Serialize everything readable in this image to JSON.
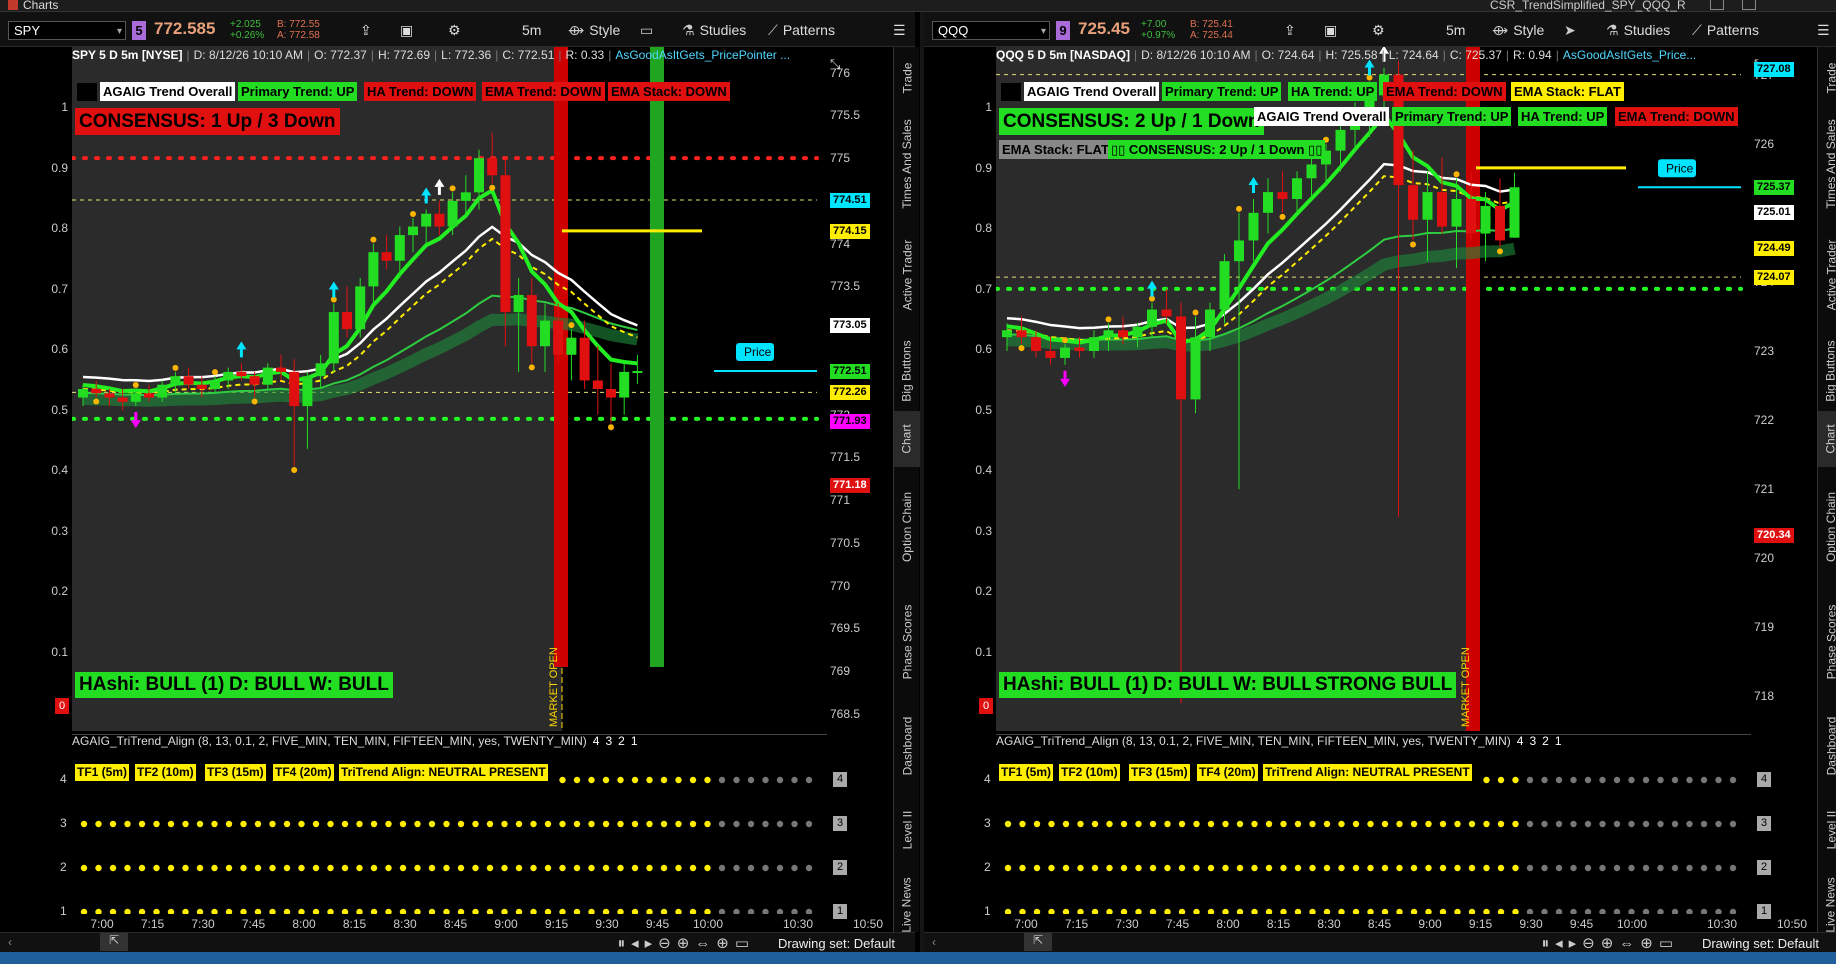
{
  "app": {
    "title": "Charts",
    "window_right": "CSR_TrendSimplified_SPY_QQQ_R"
  },
  "toolbar": {
    "style": "Style",
    "studies": "Studies",
    "patterns": "Patterns"
  },
  "vtabs": [
    "Trade",
    "Times And Sales",
    "Active Trader",
    "Big Buttons",
    "Chart",
    "Option Chain",
    "Phase Scores",
    "Dashboard",
    "Level II",
    "Live News"
  ],
  "left_axis": [
    "1",
    "0.9",
    "0.8",
    "0.7",
    "0.6",
    "0.5",
    "0.4",
    "0.3",
    "0.2",
    "0.1"
  ],
  "lower_axis": [
    "4",
    "3",
    "2",
    "1"
  ],
  "x_ticks": [
    "7:00",
    "7:15",
    "7:30",
    "7:45",
    "8:00",
    "8:15",
    "8:30",
    "8:45",
    "9:00",
    "9:15",
    "9:30",
    "9:45",
    "10:00",
    "10:30",
    "10:50"
  ],
  "bottom": {
    "drawing_set": "Drawing set: Default"
  },
  "common": {
    "market_open": "MARKET OPEN",
    "price_label": "Price",
    "zero_badge": "0"
  },
  "colors": {
    "up": "#22dd22",
    "down": "#e01010",
    "ema_white": "#ffffff",
    "yellow": "#ffee00",
    "cyan": "#00e5ff",
    "magenta": "#ff00ff"
  },
  "spy": {
    "symbol": "SPY",
    "link": "5",
    "last": "772.585",
    "change": "+2.025",
    "change_pct": "+0.26%",
    "bid": "B: 772.55",
    "ask": "A: 772.58",
    "interval": "5m",
    "info": {
      "title": "SPY 5 D 5m [NYSE]",
      "date": "D: 8/12/26 10:10 AM",
      "open": "O: 772.37",
      "high": "H: 772.69",
      "low": "L: 772.36",
      "close": "C: 772.51",
      "range": "R: 0.33",
      "study": "AsGoodAsItGets_PricePointer ..."
    },
    "labels": [
      "AGAIG Trend Overall",
      "Primary Trend: UP",
      "HA Trend: DOWN",
      "EMA Trend: DOWN",
      "EMA Stack: DOWN"
    ],
    "consensus": "CONSENSUS: 1 Up / 3 Down",
    "bulls": [
      "HAshi: BULL (1)",
      "D: BULL",
      "W: BULL"
    ],
    "price_axis": [
      "776",
      "775.5",
      "775",
      "774",
      "773.5",
      "772.5",
      "772",
      "771.5",
      "771",
      "770.5",
      "770",
      "769.5",
      "769",
      "768.5"
    ],
    "bubbles": [
      {
        "text": "774.51",
        "color": "#00e5ff"
      },
      {
        "text": "774.15",
        "color": "#ffee00"
      },
      {
        "text": "773.05",
        "color": "#ffffff"
      },
      {
        "text": "772.51",
        "color": "#22dd22"
      },
      {
        "text": "772.26",
        "color": "#ffee00"
      },
      {
        "text": "771.93",
        "color": "#ff00ff"
      },
      {
        "text": "771.18",
        "color": "#e01010"
      }
    ],
    "lower": {
      "header": "AGAIG_TriTrend_Align (8, 13, 0.1, 2, FIVE_MIN, TEN_MIN, FIFTEEN_MIN, yes, TWENTY_MIN)",
      "nums": [
        "4",
        "3",
        "2",
        "1"
      ],
      "tf": [
        "TF1 (5m)",
        "TF2 (10m)",
        "TF3 (15m)",
        "TF4 (20m)",
        "TriTrend Align: NEUTRAL PRESENT"
      ]
    },
    "chart_data": {
      "type": "candlestick",
      "ylim": [
        768.3,
        776.3
      ],
      "candles": [
        [
          772.2,
          772.35,
          772.1,
          772.3
        ],
        [
          772.3,
          772.4,
          772.2,
          772.25
        ],
        [
          772.25,
          772.3,
          772.1,
          772.2
        ],
        [
          772.2,
          772.3,
          772.05,
          772.15
        ],
        [
          772.15,
          772.3,
          772.1,
          772.25
        ],
        [
          772.25,
          772.35,
          772.15,
          772.2
        ],
        [
          772.2,
          772.4,
          772.15,
          772.35
        ],
        [
          772.35,
          772.5,
          772.25,
          772.45
        ],
        [
          772.45,
          772.55,
          772.3,
          772.35
        ],
        [
          772.35,
          772.45,
          772.2,
          772.3
        ],
        [
          772.3,
          772.45,
          772.25,
          772.4
        ],
        [
          772.4,
          772.55,
          772.3,
          772.5
        ],
        [
          772.5,
          772.6,
          772.4,
          772.45
        ],
        [
          772.45,
          772.5,
          772.2,
          772.35
        ],
        [
          772.35,
          772.6,
          772.3,
          772.55
        ],
        [
          772.55,
          772.7,
          772.4,
          772.5
        ],
        [
          772.5,
          772.65,
          771.4,
          772.1
        ],
        [
          772.1,
          772.5,
          771.6,
          772.45
        ],
        [
          772.45,
          772.7,
          772.3,
          772.6
        ],
        [
          772.6,
          773.3,
          772.5,
          773.2
        ],
        [
          773.2,
          773.5,
          772.9,
          773.0
        ],
        [
          773.0,
          773.6,
          772.9,
          773.5
        ],
        [
          773.5,
          774.0,
          773.3,
          773.9
        ],
        [
          773.9,
          774.1,
          773.7,
          773.8
        ],
        [
          773.8,
          774.2,
          773.6,
          774.1
        ],
        [
          774.1,
          774.3,
          773.9,
          774.2
        ],
        [
          774.2,
          774.4,
          774.0,
          774.35
        ],
        [
          774.35,
          774.5,
          774.1,
          774.2
        ],
        [
          774.2,
          774.6,
          774.1,
          774.5
        ],
        [
          774.5,
          774.8,
          774.3,
          774.6
        ],
        [
          774.6,
          775.1,
          774.4,
          775.0
        ],
        [
          775.0,
          775.3,
          774.7,
          774.8
        ],
        [
          774.8,
          775.0,
          772.8,
          773.2
        ],
        [
          773.2,
          773.6,
          772.5,
          773.4
        ],
        [
          773.4,
          773.6,
          772.6,
          772.8
        ],
        [
          772.8,
          773.3,
          772.5,
          773.1
        ],
        [
          773.1,
          773.3,
          772.6,
          772.7
        ],
        [
          772.7,
          773.0,
          772.4,
          772.9
        ],
        [
          772.9,
          773.1,
          772.3,
          772.4
        ],
        [
          772.4,
          772.8,
          772.0,
          772.3
        ],
        [
          772.3,
          772.6,
          771.9,
          772.2
        ],
        [
          772.2,
          772.6,
          772.0,
          772.5
        ],
        [
          772.5,
          772.7,
          772.36,
          772.51
        ]
      ]
    }
  },
  "qqq": {
    "symbol": "QQQ",
    "link": "9",
    "last": "725.45",
    "change": "+7.00",
    "change_pct": "+0.97%",
    "bid": "B: 725.41",
    "ask": "A: 725.44",
    "interval": "5m",
    "info": {
      "title": "QQQ 5 D 5m [NASDAQ]",
      "date": "D: 8/12/26 10:10 AM",
      "open": "O: 724.64",
      "high": "H: 725.58",
      "low": "L: 724.64",
      "close": "C: 725.37",
      "range": "R: 0.94",
      "study": "AsGoodAsItGets_Price..."
    },
    "labels": [
      "AGAIG Trend Overall",
      "Primary Trend: UP",
      "HA Trend: UP",
      "EMA Trend: DOWN",
      "EMA Stack: FLAT"
    ],
    "consensus": "CONSENSUS: 2 Up / 1 Down",
    "labels2": [
      "AGAIG Trend Overall",
      "Primary Trend: UP",
      "HA Trend: UP",
      "EMA Trend: DOWN"
    ],
    "labels3": [
      "EMA Stack: FLAT",
      "▯▯ CONSENSUS: 2 Up / 1 Down ▯▯"
    ],
    "bulls": [
      "HAshi: BULL (1)",
      "D: BULL",
      "W: BULL",
      "STRONG BULL"
    ],
    "price_axis": [
      "727",
      "726",
      "725",
      "724",
      "723",
      "722",
      "721",
      "720",
      "719",
      "718"
    ],
    "bubbles": [
      {
        "text": "727.08",
        "color": "#00e5ff"
      },
      {
        "text": "725.37",
        "color": "#22dd22"
      },
      {
        "text": "725.01",
        "color": "#ffffff"
      },
      {
        "text": "724.49",
        "color": "#ffee00"
      },
      {
        "text": "724.07",
        "color": "#ffee00"
      },
      {
        "text": "720.34",
        "color": "#e01010"
      }
    ],
    "lower": {
      "header": "AGAIG_TriTrend_Align (8, 13, 0.1, 2, FIVE_MIN, TEN_MIN, FIFTEEN_MIN, yes, TWENTY_MIN)",
      "nums": [
        "4",
        "3",
        "2",
        "1"
      ],
      "tf": [
        "TF1 (5m)",
        "TF2 (10m)",
        "TF3 (15m)",
        "TF4 (20m)",
        "TriTrend Align: NEUTRAL PRESENT"
      ]
    },
    "chart_data": {
      "type": "candlestick",
      "ylim": [
        717.5,
        727.4
      ],
      "candles": [
        [
          723.2,
          723.4,
          723.0,
          723.3
        ],
        [
          723.3,
          723.5,
          723.1,
          723.2
        ],
        [
          723.2,
          723.3,
          722.9,
          723.0
        ],
        [
          723.0,
          723.2,
          722.8,
          722.9
        ],
        [
          722.9,
          723.1,
          722.8,
          723.05
        ],
        [
          723.05,
          723.2,
          722.9,
          723.0
        ],
        [
          723.0,
          723.3,
          722.9,
          723.2
        ],
        [
          723.2,
          723.4,
          723.0,
          723.3
        ],
        [
          723.3,
          723.5,
          723.1,
          723.2
        ],
        [
          723.2,
          723.4,
          723.05,
          723.35
        ],
        [
          723.35,
          723.7,
          723.2,
          723.6
        ],
        [
          723.6,
          723.9,
          723.4,
          723.5
        ],
        [
          723.5,
          723.7,
          717.9,
          722.3
        ],
        [
          722.3,
          723.5,
          722.1,
          723.2
        ],
        [
          723.2,
          723.7,
          723.0,
          723.6
        ],
        [
          723.6,
          724.4,
          723.4,
          724.3
        ],
        [
          724.3,
          725.0,
          721.0,
          724.6
        ],
        [
          724.6,
          725.2,
          724.3,
          725.0
        ],
        [
          725.0,
          725.5,
          724.7,
          725.3
        ],
        [
          725.3,
          725.6,
          725.0,
          725.2
        ],
        [
          725.2,
          725.6,
          725.0,
          725.5
        ],
        [
          725.5,
          725.8,
          725.2,
          725.7
        ],
        [
          725.7,
          726.0,
          725.4,
          725.9
        ],
        [
          725.9,
          726.3,
          725.6,
          726.2
        ],
        [
          726.2,
          726.6,
          725.9,
          726.5
        ],
        [
          726.5,
          726.9,
          726.1,
          726.7
        ],
        [
          726.7,
          727.1,
          726.3,
          727.0
        ],
        [
          727.0,
          727.2,
          720.6,
          725.4
        ],
        [
          725.4,
          725.9,
          724.6,
          724.9
        ],
        [
          724.9,
          725.6,
          724.3,
          725.3
        ],
        [
          725.3,
          725.8,
          724.7,
          724.8
        ],
        [
          724.8,
          725.5,
          724.2,
          725.2
        ],
        [
          725.2,
          725.6,
          724.6,
          724.7
        ],
        [
          724.7,
          725.3,
          724.3,
          725.1
        ],
        [
          725.1,
          725.5,
          724.5,
          724.6
        ],
        [
          724.64,
          725.58,
          724.64,
          725.37
        ]
      ]
    }
  }
}
